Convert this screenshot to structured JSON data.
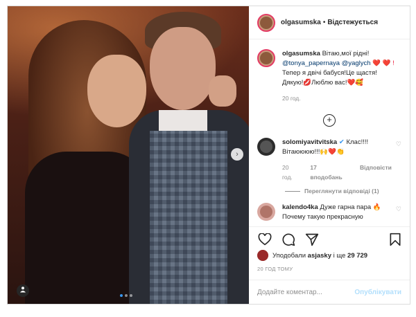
{
  "post": {
    "author": "olgasumska",
    "follow_label": "Відстежується",
    "separator": "•",
    "caption_text": "Вітаю,мої рідні!",
    "mention_1": "@tonya_papernaya",
    "mention_2": "@yaglych",
    "caption_line_2": "Тепер я двічі бабуся!Це щастя!",
    "caption_line_3": "Дякую!💋Люблю вас!❤️🥰",
    "caption_hearts": "❤️ ❤️ !",
    "caption_time": "20 год."
  },
  "comments": [
    {
      "author": "solomiyavitvitska",
      "verified": true,
      "text": "Клас!!!! Вітаюююю!!!🙌❤️👏",
      "time": "20 год.",
      "likes": "17 вподобань",
      "reply_label": "Відповісти",
      "view_replies": "Переглянути відповіді (1)"
    },
    {
      "author": "kalendo4ka",
      "text": "Дуже гарна пара 🔥",
      "text_2": "Почему такую прекрасную"
    }
  ],
  "likes": {
    "prefix": "Уподобали",
    "user": "asjasky",
    "middle": "і ще",
    "count": "29 729"
  },
  "time_ago": "20 ГОД ТОМУ",
  "add_comment": {
    "placeholder": "Додайте коментар...",
    "publish_label": "Опублікувати"
  },
  "icons": {
    "like": "heart-icon",
    "comment": "comment-icon",
    "share": "share-icon",
    "save": "bookmark-icon",
    "more_comments": "plus-circle-icon",
    "next": "chevron-right-icon",
    "tag": "user-tag-icon"
  },
  "colors": {
    "accent": "#3897f0",
    "heart": "#ed1c3c",
    "publish_disabled": "#b2dffc",
    "link": "#00376b"
  }
}
